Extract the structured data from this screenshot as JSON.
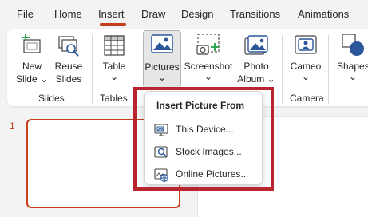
{
  "tabs": [
    {
      "label": "File"
    },
    {
      "label": "Home"
    },
    {
      "label": "Insert",
      "active": true
    },
    {
      "label": "Draw"
    },
    {
      "label": "Design"
    },
    {
      "label": "Transitions"
    },
    {
      "label": "Animations"
    }
  ],
  "ribbon": {
    "new_slide": {
      "line1": "New",
      "line2": "Slide",
      "icon": "new-slide-icon"
    },
    "reuse_slides": {
      "line1": "Reuse",
      "line2": "Slides",
      "icon": "reuse-slides-icon"
    },
    "table": {
      "label": "Table",
      "icon": "table-icon"
    },
    "pictures": {
      "label": "Pictures",
      "icon": "pictures-icon"
    },
    "screenshot": {
      "label": "Screenshot",
      "icon": "screenshot-icon"
    },
    "photo_album": {
      "line1": "Photo",
      "line2": "Album",
      "icon": "photo-album-icon"
    },
    "cameo": {
      "label": "Cameo",
      "icon": "cameo-icon"
    },
    "shapes": {
      "label": "Shapes",
      "icon": "shapes-icon"
    },
    "groups": {
      "slides": "Slides",
      "tables": "Tables",
      "camera": "Camera"
    }
  },
  "slide_panel": {
    "slide_number": "1"
  },
  "picture_menu": {
    "title": "Insert Picture From",
    "items": [
      {
        "label": "This Device...",
        "icon": "this-device-icon",
        "access_key": "D"
      },
      {
        "label": "Stock Images...",
        "icon": "stock-images-icon",
        "access_key": "S"
      },
      {
        "label": "Online Pictures...",
        "icon": "online-pictures-icon",
        "access_key": "O"
      }
    ]
  },
  "colors": {
    "accent": "#c43e1c",
    "highlight_box": "#b8252e",
    "icon_blue": "#2b579a",
    "icon_green": "#33a852"
  }
}
